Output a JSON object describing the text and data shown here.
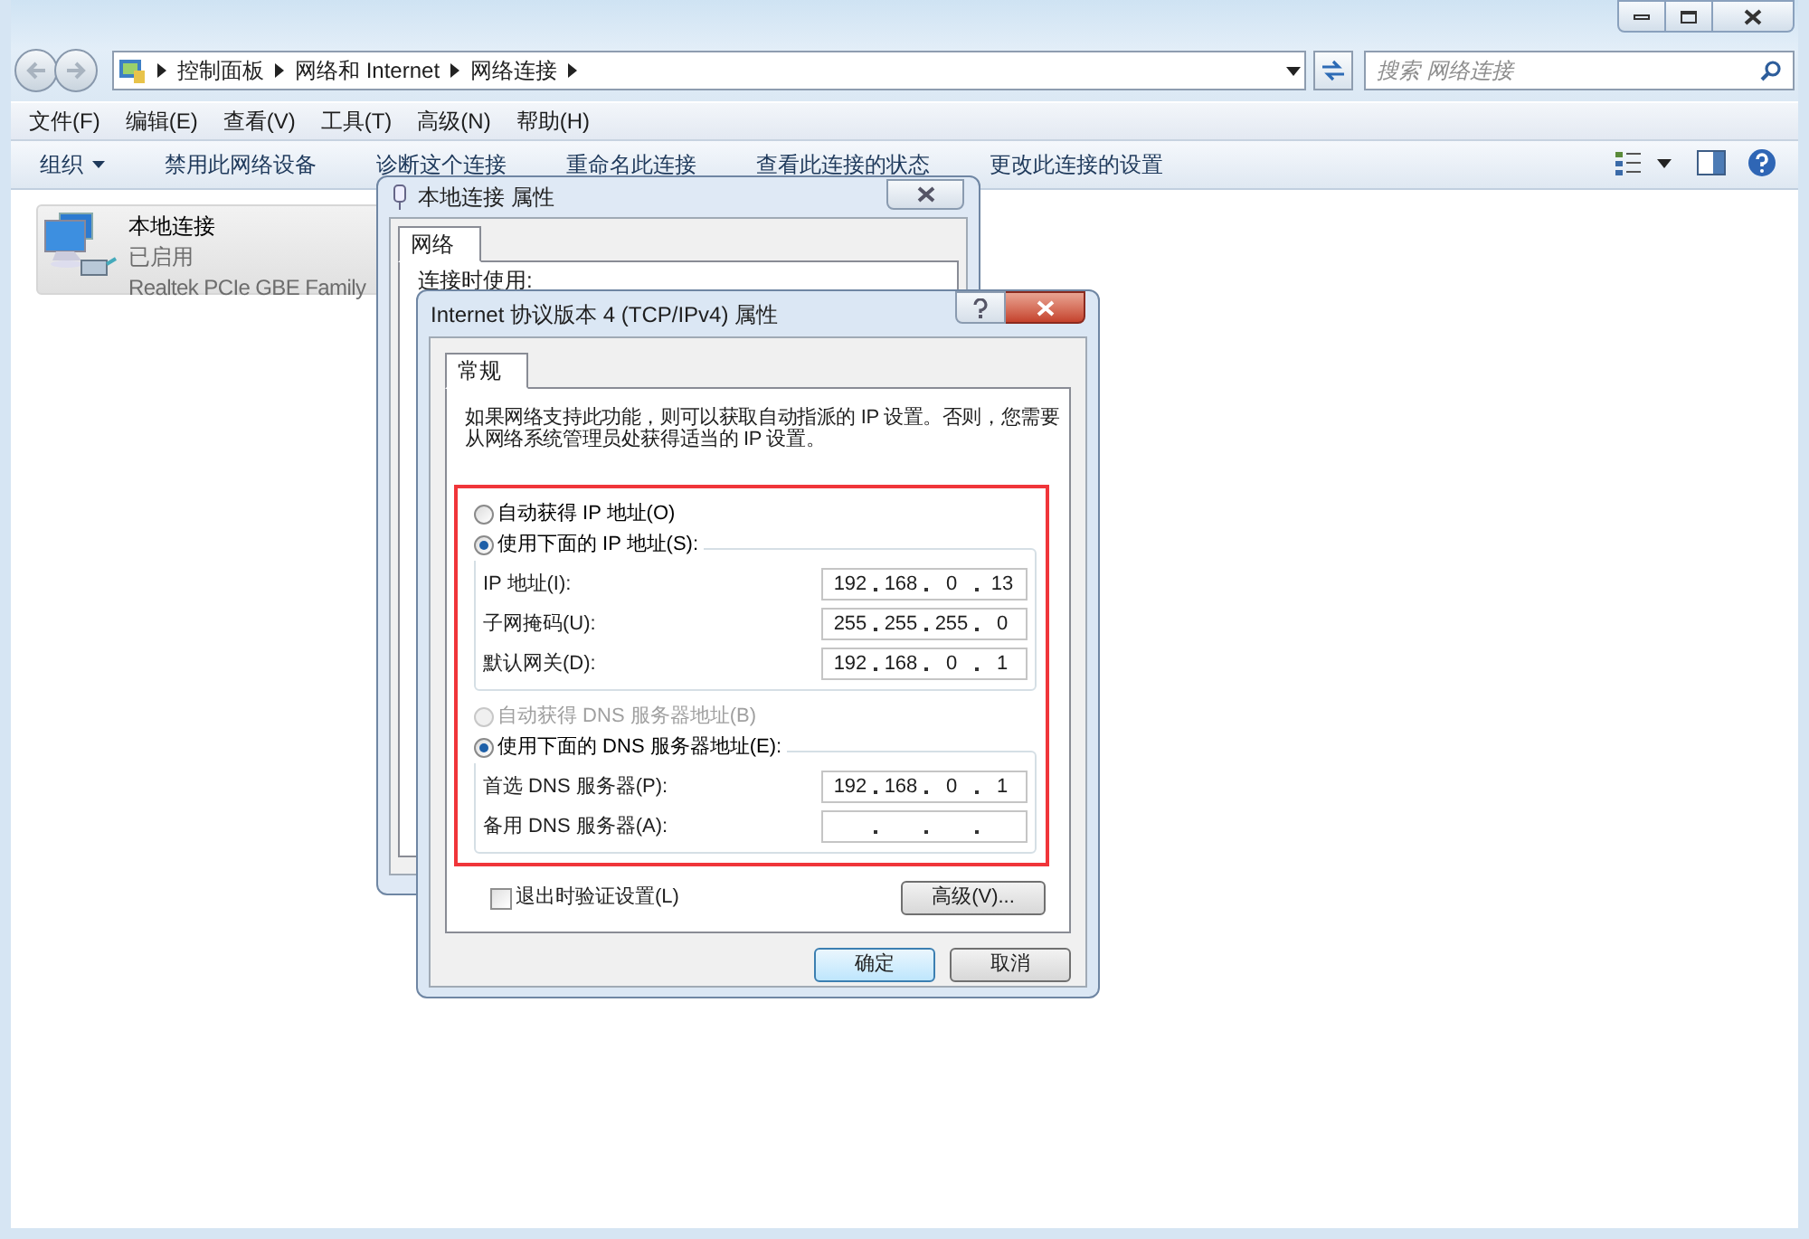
{
  "address_bar": {
    "breadcrumb": [
      "控制面板",
      "网络和 Internet",
      "网络连接"
    ]
  },
  "search": {
    "placeholder": "搜索 网络连接"
  },
  "menu": [
    "文件(F)",
    "编辑(E)",
    "查看(V)",
    "工具(T)",
    "高级(N)",
    "帮助(H)"
  ],
  "toolbar": [
    {
      "label": "组织",
      "kind": "dropdown"
    },
    {
      "label": "禁用此网络设备",
      "kind": "plain"
    },
    {
      "label": "诊断这个连接",
      "kind": "plain"
    },
    {
      "label": "重命名此连接",
      "kind": "plain"
    },
    {
      "label": "查看此连接的状态",
      "kind": "plain"
    },
    {
      "label": "更改此连接的设置",
      "kind": "plain"
    }
  ],
  "connections": [
    {
      "name": "本地连接",
      "status": "已启用",
      "adapter": "Realtek PCIe GBE Family",
      "selected": true
    }
  ],
  "properties_dialog": {
    "title": "本地连接 属性",
    "tabs": [
      {
        "label": "网络",
        "selected": true
      }
    ],
    "connect_using_label": "连接时使用:"
  },
  "ipv4_dialog": {
    "title": "Internet 协议版本 4 (TCP/IPv4) 属性",
    "tabs": [
      {
        "label": "常规",
        "selected": true
      }
    ],
    "description": "如果网络支持此功能，则可以获取自动指派的 IP 设置。否则，您需要从网络系统管理员处获得适当的 IP 设置。",
    "ip_modes": [
      {
        "label": "自动获得 IP 地址(O)",
        "selected": false,
        "disabled": false
      },
      {
        "label": "使用下面的 IP 地址(S):",
        "selected": true,
        "disabled": false
      }
    ],
    "ip_fields": [
      {
        "label": "IP 地址(I):",
        "octets": [
          "192",
          "168",
          "0",
          "13"
        ]
      },
      {
        "label": "子网掩码(U):",
        "octets": [
          "255",
          "255",
          "255",
          "0"
        ]
      },
      {
        "label": "默认网关(D):",
        "octets": [
          "192",
          "168",
          "0",
          "1"
        ]
      }
    ],
    "dns_modes": [
      {
        "label": "自动获得 DNS 服务器地址(B)",
        "selected": false,
        "disabled": true
      },
      {
        "label": "使用下面的 DNS 服务器地址(E):",
        "selected": true,
        "disabled": false
      }
    ],
    "dns_fields": [
      {
        "label": "首选 DNS 服务器(P):",
        "octets": [
          "192",
          "168",
          "0",
          "1"
        ]
      },
      {
        "label": "备用 DNS 服务器(A):"
      }
    ],
    "validate_checkbox": {
      "label": "退出时验证设置(L)",
      "checked": false
    },
    "advanced_button": "高级(V)...",
    "ok_button": "确定",
    "cancel_button": "取消"
  }
}
